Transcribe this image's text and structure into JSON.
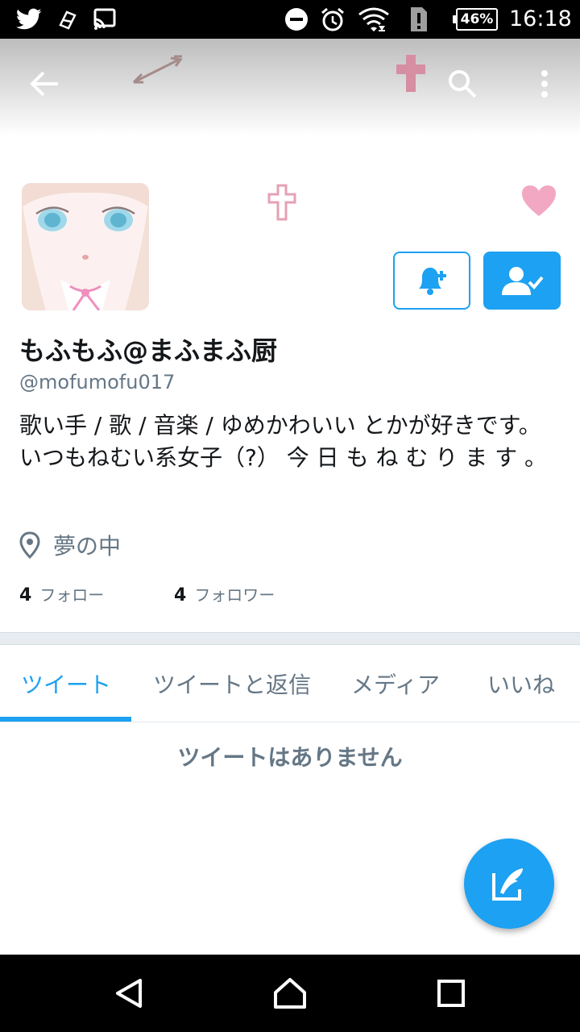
{
  "status_bar": {
    "time": "16:18",
    "battery": "46%",
    "icons": [
      "twitter-icon",
      "clean-master-icon",
      "cast-icon",
      "do-not-disturb-icon",
      "alarm-icon",
      "wifi-icon",
      "signal-alert-icon",
      "battery-icon"
    ]
  },
  "toolbar": {
    "back_icon": "arrow-back-icon",
    "search_icon": "search-icon",
    "more_icon": "more-vert-icon"
  },
  "profile": {
    "display_name": "もふもふ@まふまふ厨",
    "handle": "@mofumofu017",
    "bio": "歌い手 / 歌 / 音楽 / ゆめかわいい とかが好きです。いつもねむい系女子（?） 今 日 も ね む り ま す 。",
    "location": "夢の中",
    "following_count": "4",
    "following_label": "フォロー",
    "followers_count": "4",
    "followers_label": "フォロワー",
    "notify_icon": "bell-plus-icon",
    "following_icon": "user-check-icon"
  },
  "tabs": [
    {
      "label": "ツイート",
      "active": true
    },
    {
      "label": "ツイートと返信",
      "active": false
    },
    {
      "label": "メディア",
      "active": false
    },
    {
      "label": "いいね",
      "active": false
    }
  ],
  "empty_state": "ツイートはありません",
  "fab_icon": "compose-tweet-icon",
  "colors": {
    "accent": "#1da1f2",
    "text_primary": "#14171a",
    "text_secondary": "#657786"
  }
}
